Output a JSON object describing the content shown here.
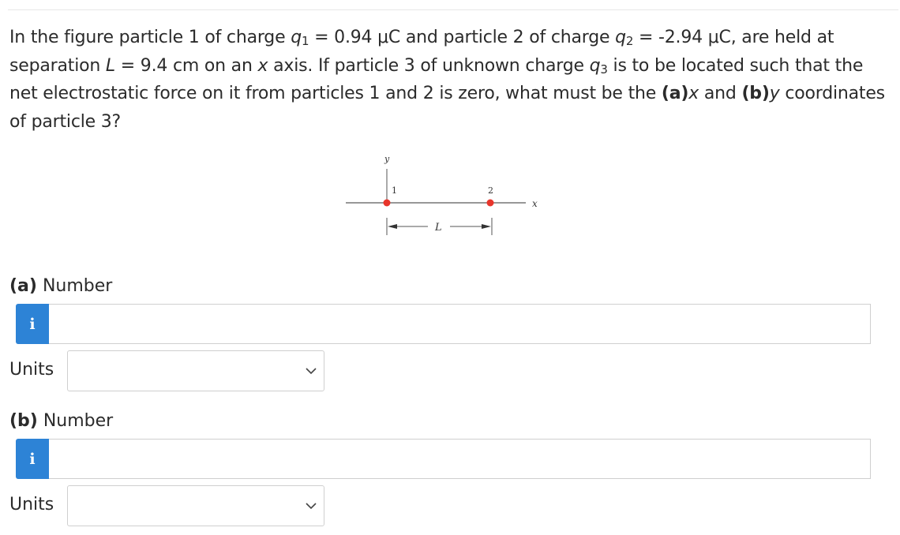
{
  "question": {
    "p1": "In the figure particle 1 of charge ",
    "q1_sym": "q",
    "q1_sub": "1",
    "q1_val": " = 0.94 μC and particle 2 of charge ",
    "q2_sym": "q",
    "q2_sub": "2",
    "q2_val": " = -2.94 μC, are held at separation ",
    "L_sym": "L",
    "L_val": " = 9.4 cm on an ",
    "x_sym": "x",
    "p2": " axis. If particle 3 of unknown charge ",
    "q3_sym": "q",
    "q3_sub": "3",
    "p3": " is to be located such that the net electrostatic force on it from particles 1 and 2 is zero, what must be the ",
    "a_tag": "(a)",
    "a_var": "x",
    "p4": " and ",
    "b_tag": "(b)",
    "b_var": "y",
    "p5": " coordinates of particle 3?"
  },
  "figure": {
    "y_axis_label": "y",
    "x_axis_label": "x",
    "particle1_label": "1",
    "particle2_label": "2",
    "separation_label": "L",
    "particle_color": "#e8352b"
  },
  "part_a": {
    "tag": "(a)",
    "label": " Number",
    "info_icon": "i",
    "number_value": "",
    "units_label": "Units",
    "units_value": ""
  },
  "part_b": {
    "tag": "(b)",
    "label": " Number",
    "info_icon": "i",
    "number_value": "",
    "units_label": "Units",
    "units_value": ""
  },
  "colors": {
    "info_button": "#2d83d6",
    "border": "#cfcfcf",
    "text": "#2b2b2b"
  }
}
